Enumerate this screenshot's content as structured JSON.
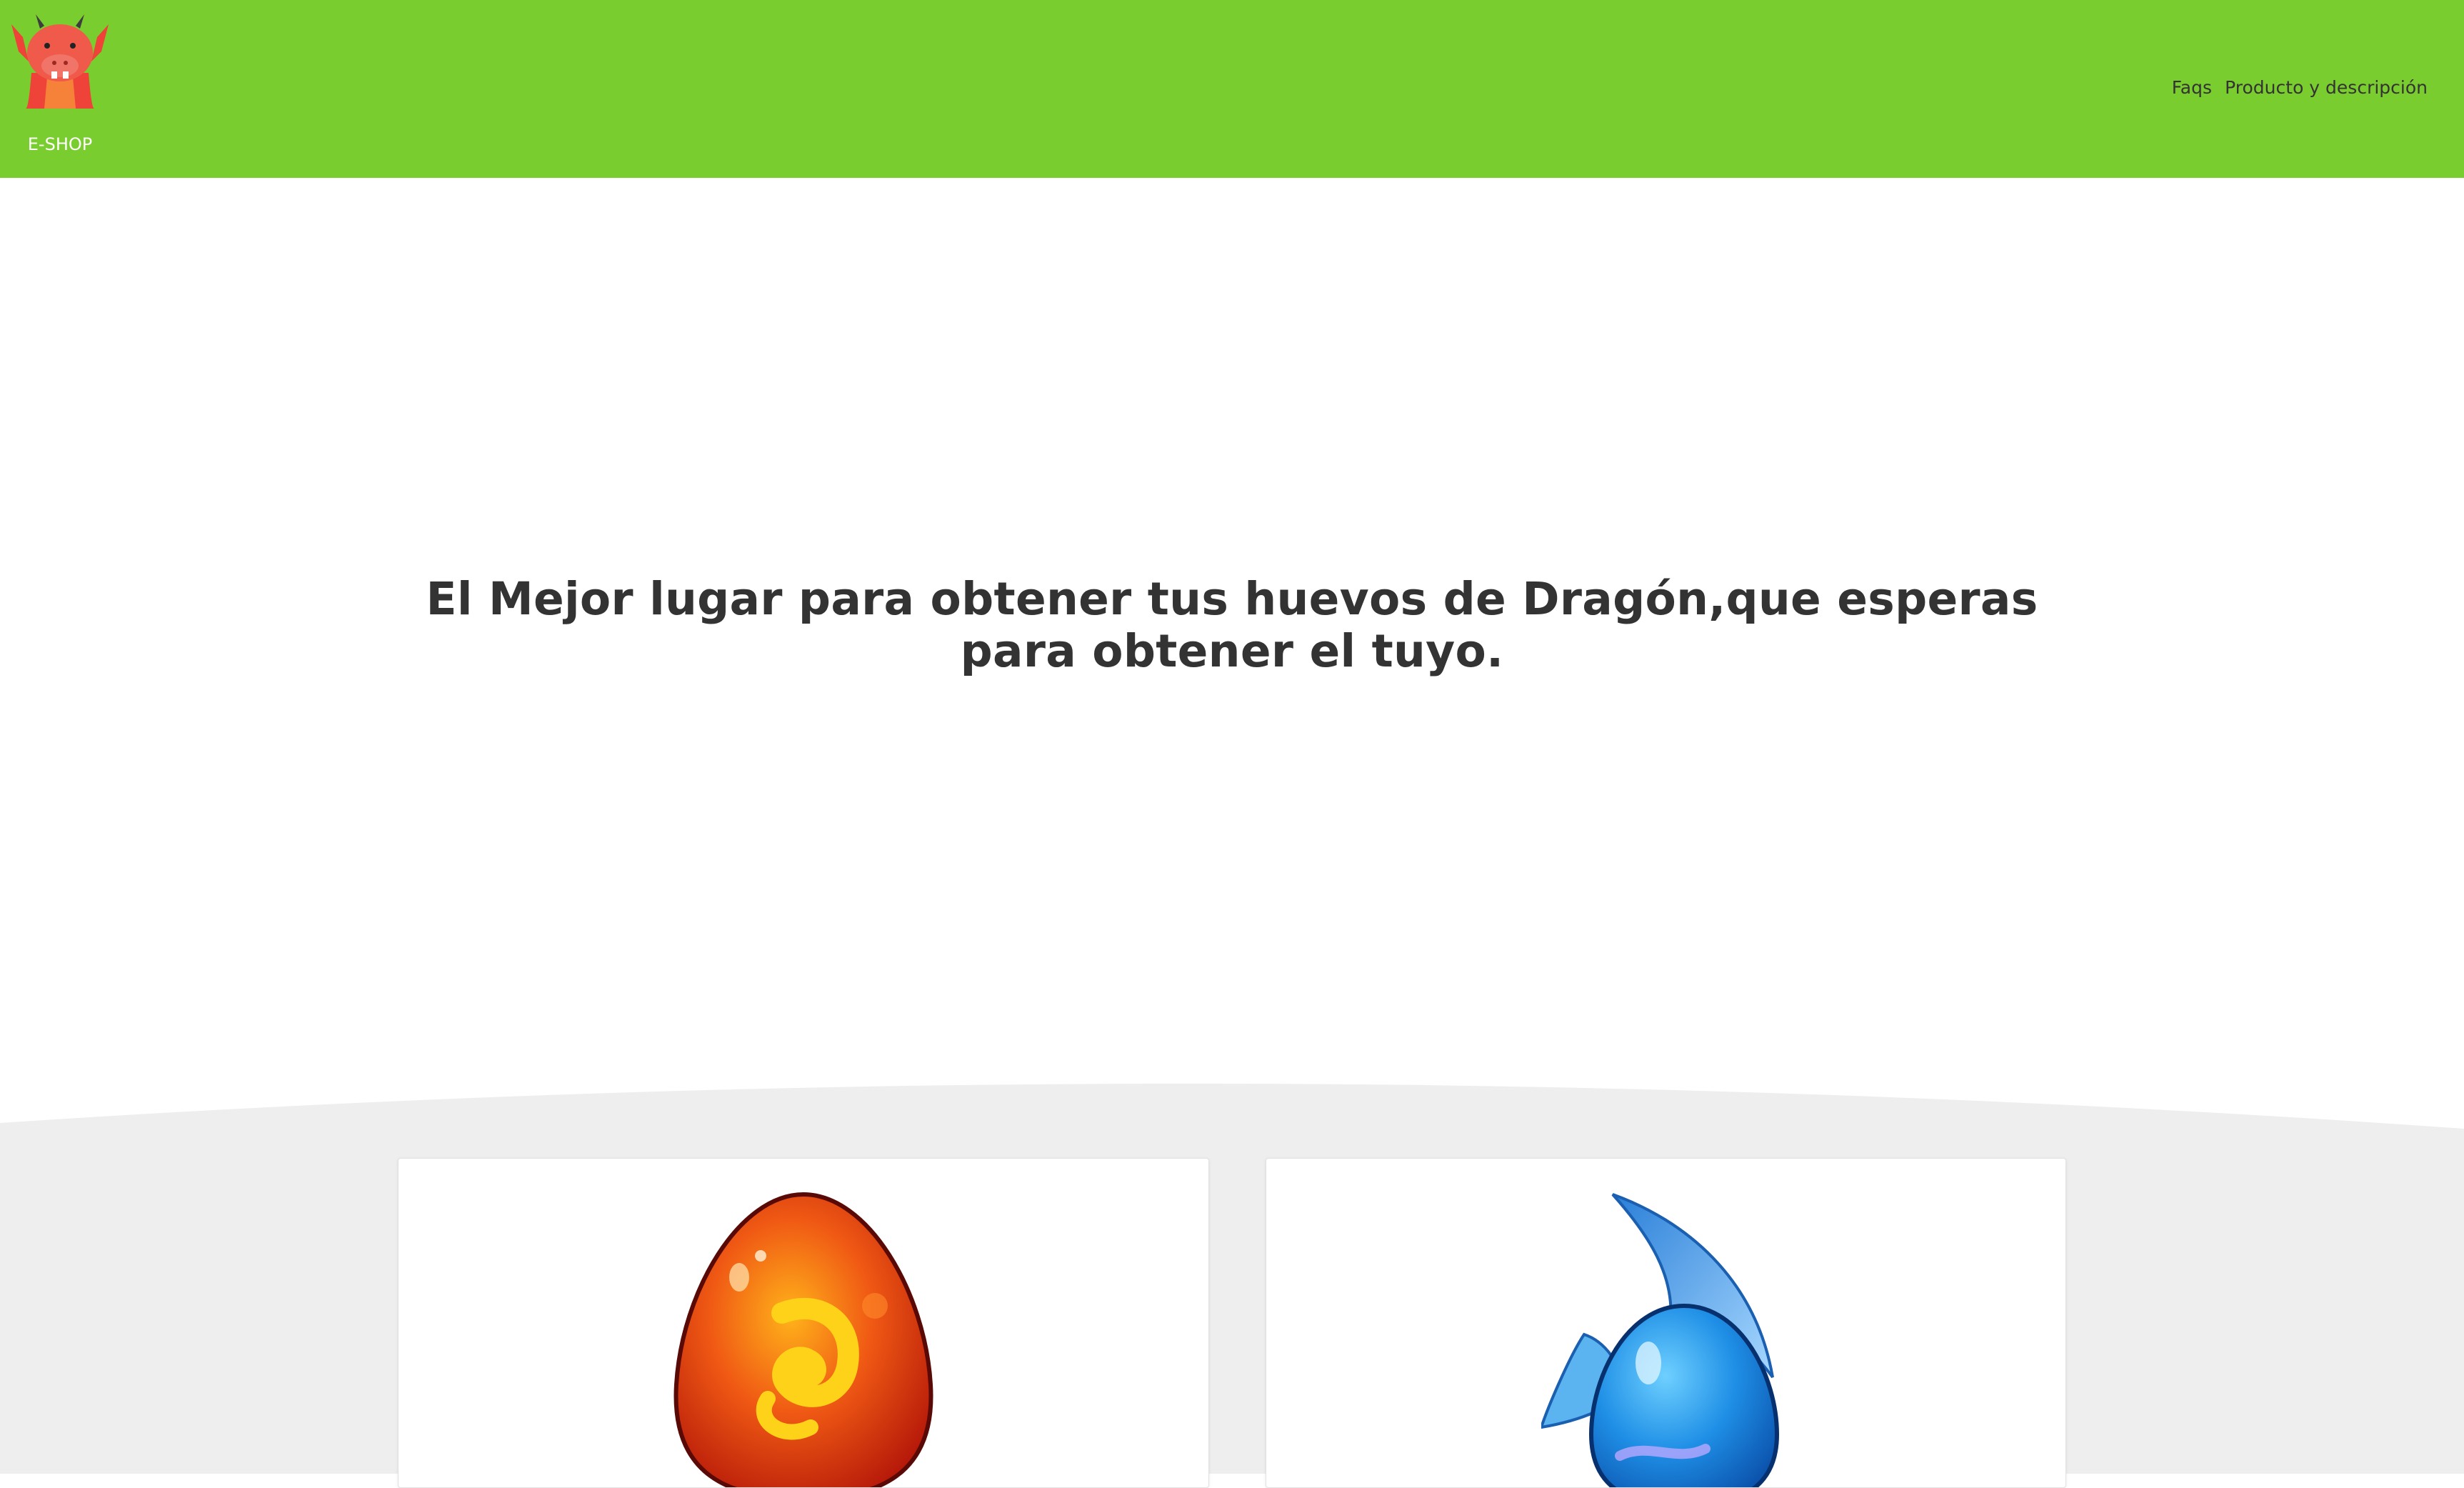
{
  "header": {
    "logo_text": "E-SHOP",
    "logo_icon": "dragon-logo-icon",
    "background_color": "#7acd2e",
    "nav": [
      {
        "label": "Faqs"
      },
      {
        "label": "Producto y descripción"
      }
    ]
  },
  "hero": {
    "title": "El Mejor lugar para obtener tus huevos de Dragón,que esperas para obtener el tuyo."
  },
  "products": [
    {
      "image": "fire-egg-image",
      "color": "#d92b0e"
    },
    {
      "image": "water-egg-image",
      "color": "#2a8fe0"
    }
  ]
}
